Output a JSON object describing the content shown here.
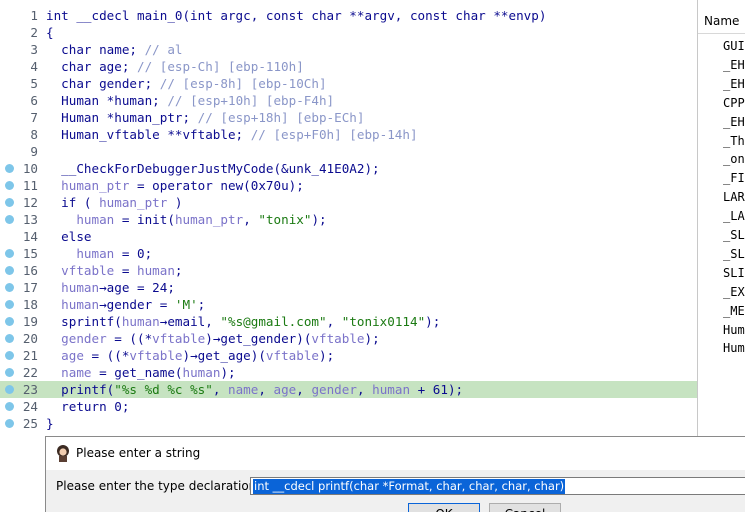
{
  "code": {
    "lines": [
      {
        "num": "1",
        "bp": false,
        "hl": false,
        "html": "int __cdecl main_0(int argc, const char **argv, const char **envp)"
      },
      {
        "num": "2",
        "bp": false,
        "hl": false,
        "html": "{"
      },
      {
        "num": "3",
        "bp": false,
        "hl": false,
        "html": "  char name; <span class=\"c\">// al</span>"
      },
      {
        "num": "4",
        "bp": false,
        "hl": false,
        "html": "  char age; <span class=\"c\">// [esp-Ch] [ebp-110h]</span>"
      },
      {
        "num": "5",
        "bp": false,
        "hl": false,
        "html": "  char gender; <span class=\"c\">// [esp-8h] [ebp-10Ch]</span>"
      },
      {
        "num": "6",
        "bp": false,
        "hl": false,
        "html": "  Human *human; <span class=\"c\">// [esp+10h] [ebp-F4h]</span>"
      },
      {
        "num": "7",
        "bp": false,
        "hl": false,
        "html": "  Human *human_ptr; <span class=\"c\">// [esp+18h] [ebp-ECh]</span>"
      },
      {
        "num": "8",
        "bp": false,
        "hl": false,
        "html": "  Human_vftable **vftable; <span class=\"c\">// [esp+F0h] [ebp-14h]</span>"
      },
      {
        "num": "9",
        "bp": false,
        "hl": false,
        "html": ""
      },
      {
        "num": "10",
        "bp": true,
        "hl": false,
        "html": "  __CheckForDebuggerJustMyCode(&amp;unk_41E0A2);"
      },
      {
        "num": "11",
        "bp": true,
        "hl": false,
        "html": "  <span class=\"v\">human_ptr</span> = operator new(0x70u);"
      },
      {
        "num": "12",
        "bp": true,
        "hl": false,
        "html": "  if ( <span class=\"v\">human_ptr</span> )"
      },
      {
        "num": "13",
        "bp": true,
        "hl": false,
        "html": "    <span class=\"v\">human</span> = init(<span class=\"v\">human_ptr</span>, <span class=\"s\">\"tonix\"</span>);"
      },
      {
        "num": "14",
        "bp": false,
        "hl": false,
        "html": "  else"
      },
      {
        "num": "15",
        "bp": true,
        "hl": false,
        "html": "    <span class=\"v\">human</span> = 0;"
      },
      {
        "num": "16",
        "bp": true,
        "hl": false,
        "html": "  <span class=\"v\">vftable</span> = <span class=\"v\">human</span>;"
      },
      {
        "num": "17",
        "bp": true,
        "hl": false,
        "html": "  <span class=\"v\">human</span>→age = 24;"
      },
      {
        "num": "18",
        "bp": true,
        "hl": false,
        "html": "  <span class=\"v\">human</span>→gender = <span class=\"s\">'M'</span>;"
      },
      {
        "num": "19",
        "bp": true,
        "hl": false,
        "html": "  sprintf(<span class=\"v\">human</span>→email, <span class=\"s\">\"%s@gmail.com\"</span>, <span class=\"s\">\"tonix0114\"</span>);"
      },
      {
        "num": "20",
        "bp": true,
        "hl": false,
        "html": "  <span class=\"v\">gender</span> = ((*<span class=\"v\">vftable</span>)→get_gender)(<span class=\"v\">vftable</span>);"
      },
      {
        "num": "21",
        "bp": true,
        "hl": false,
        "html": "  <span class=\"v\">age</span> = ((*<span class=\"v\">vftable</span>)→get_age)(<span class=\"v\">vftable</span>);"
      },
      {
        "num": "22",
        "bp": true,
        "hl": false,
        "html": "  <span class=\"v\">name</span> = get_name(<span class=\"v\">human</span>);"
      },
      {
        "num": "23",
        "bp": true,
        "hl": true,
        "html": "  printf(<span class=\"s\">\"%s %d %c %s\"</span>, <span class=\"v\">name</span>, <span class=\"v\">age</span>, <span class=\"v\">gender</span>, <span class=\"v\">human</span> + 61);"
      },
      {
        "num": "24",
        "bp": true,
        "hl": false,
        "html": "  return 0;"
      },
      {
        "num": "25",
        "bp": true,
        "hl": false,
        "html": "}"
      }
    ]
  },
  "names_pane": {
    "header": "Name",
    "items": [
      "GUI",
      "_EH",
      "_EH",
      "CPP",
      "_EH",
      "_Th",
      "_on",
      "_FI",
      "LAR",
      "_LA",
      "_SL",
      "_SL",
      "SLI",
      "_EX",
      "_ME",
      "Hum",
      "Hum"
    ]
  },
  "dialog": {
    "title": "Please enter a string",
    "label": "Please enter the type declaration",
    "input_value": "int __cdecl printf(char *Format, char, char, char, char)",
    "ok_label": "OK",
    "cancel_label": "Cancel"
  },
  "colors": {
    "highlight_line": "#c6e3c1",
    "breakpoint_dot": "#7ec6e9",
    "selection": "#0a64d8"
  }
}
